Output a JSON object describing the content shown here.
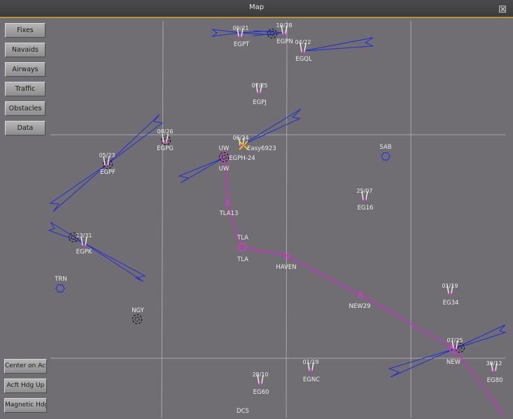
{
  "window": {
    "title": "Map"
  },
  "buttons": {
    "fixes": "Fixes",
    "navaids": "Navaids",
    "airways": "Airways",
    "traffic": "Traffic",
    "obstacles": "Obstacles",
    "data": "Data",
    "center_on_acft": "Center on Acft",
    "acft_hdg_up": "Acft Hdg Up",
    "magnetic_hdgs": "Magnetic Hdgs"
  },
  "airports": {
    "egpt": {
      "name": "EGPT",
      "rwy": "09/21"
    },
    "egpn": {
      "name": "EGPN",
      "rwy": "10/28"
    },
    "egql": {
      "name": "EGQL",
      "rwy": "04/22"
    },
    "egpj": {
      "name": "EGPJ",
      "rwy": "07/25"
    },
    "egpg": {
      "name": "EGPG",
      "rwy": "08/26"
    },
    "egph": {
      "name": "EGPH-24",
      "rwy": "06/24"
    },
    "egpf": {
      "name": "EGPF",
      "rwy": "05/23"
    },
    "egpk": {
      "name": "EGPK",
      "rwy": "13/31"
    },
    "eg16": {
      "name": "EG16",
      "rwy": "25/07"
    },
    "eg34": {
      "name": "EG34",
      "rwy": "01/19"
    },
    "new_ap": {
      "rwy": "07/25"
    },
    "eg80": {
      "name": "EG80",
      "rwy": "30/12"
    },
    "eg60": {
      "name": "EG60",
      "rwy": "28/10"
    },
    "egnc": {
      "name": "EGNC",
      "rwy": "01/19"
    }
  },
  "fixes": {
    "uw_top": "UW",
    "uw_bot": "UW",
    "tla13": "TLA13",
    "tla_top": "TLA",
    "tla_bot": "TLA",
    "haven": "HAVEN",
    "new29": "NEW29",
    "new": "NEW",
    "sab": "SAB",
    "trn": "TRN",
    "ngy": "NGY",
    "dcs": "DCS"
  },
  "traffic": {
    "callsign": "Easy6923"
  },
  "colors": {
    "map_bg": "#706e72",
    "route": "#c832c8",
    "ils": "#1f2fd6",
    "grid": "#a9a7ab",
    "title_accent": "#b8952f"
  },
  "icons": [
    "airport-icon",
    "vor-icon",
    "ndb-icon",
    "aircraft-icon",
    "close-icon"
  ]
}
